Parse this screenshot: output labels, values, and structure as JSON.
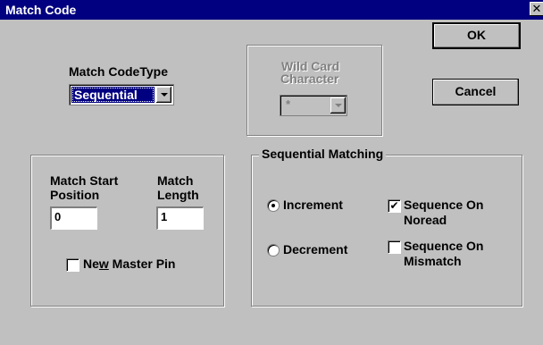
{
  "window": {
    "title": "Match Code",
    "close_glyph": "✕"
  },
  "match_code_type": {
    "label": "Match CodeType",
    "selected": "Sequential",
    "arrow_icon": "chevron-down-icon"
  },
  "wild_card": {
    "label_line1": "Wild Card",
    "label_line2": "Character",
    "selected": "*"
  },
  "buttons": {
    "ok": "OK",
    "cancel": "Cancel"
  },
  "positions": {
    "start_label_line1": "Match Start",
    "start_label_line2": "Position",
    "start_value": "0",
    "length_label_line1": "Match",
    "length_label_line2": "Length",
    "length_value": "1",
    "new_master_pin_pre": "Ne",
    "new_master_pin_u": "w",
    "new_master_pin_post": " Master Pin",
    "new_master_pin_checked": false
  },
  "sequential": {
    "title": "Sequential Matching",
    "increment": "Increment",
    "decrement": "Decrement",
    "selected": "Increment",
    "noread_line1": "Sequence On",
    "noread_line2": "Noread",
    "noread_checked": true,
    "mismatch_line1": "Sequence On",
    "mismatch_line2": "Mismatch",
    "mismatch_checked": false,
    "check_glyph": "✔"
  }
}
